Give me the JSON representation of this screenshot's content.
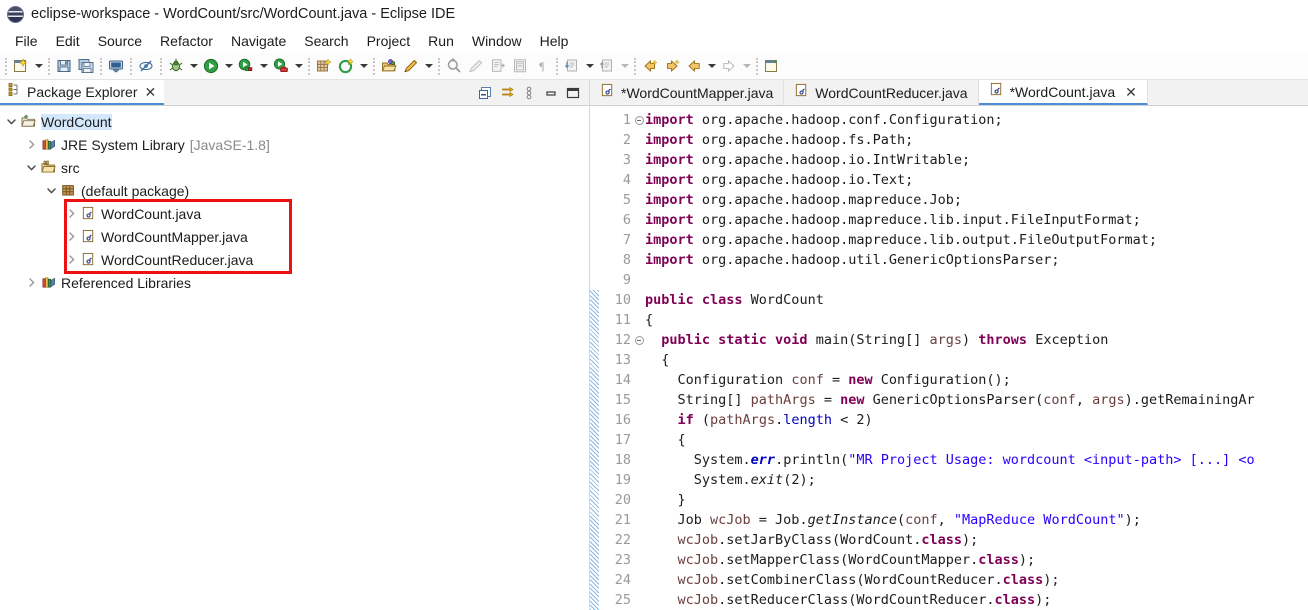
{
  "window": {
    "title": "eclipse-workspace - WordCount/src/WordCount.java - Eclipse IDE",
    "app_icon": "eclipse-logo-icon"
  },
  "menubar": {
    "items": [
      {
        "label": "File"
      },
      {
        "label": "Edit"
      },
      {
        "label": "Source"
      },
      {
        "label": "Refactor"
      },
      {
        "label": "Navigate"
      },
      {
        "label": "Search"
      },
      {
        "label": "Project"
      },
      {
        "label": "Run"
      },
      {
        "label": "Window"
      },
      {
        "label": "Help"
      }
    ]
  },
  "toolbar": {
    "groups": [
      {
        "buttons": [
          {
            "icon": "new-wizard-icon",
            "dropdown": true
          }
        ]
      },
      {
        "buttons": [
          {
            "icon": "save-icon",
            "dropdown": false
          },
          {
            "icon": "save-all-icon",
            "dropdown": false
          }
        ]
      },
      {
        "buttons": [
          {
            "icon": "print-icon",
            "dropdown": false
          }
        ]
      },
      {
        "buttons": [
          {
            "icon": "toggle-mark-occurrences-icon",
            "dropdown": false
          }
        ]
      },
      {
        "buttons": [
          {
            "icon": "debug-icon",
            "dropdown": true
          },
          {
            "icon": "run-icon",
            "dropdown": true
          },
          {
            "icon": "run-coverage-icon",
            "dropdown": true
          },
          {
            "icon": "external-tools-icon",
            "dropdown": true
          }
        ]
      },
      {
        "buttons": [
          {
            "icon": "new-java-project-icon",
            "dropdown": false
          },
          {
            "icon": "new-package-icon",
            "dropdown": true
          }
        ]
      },
      {
        "buttons": [
          {
            "icon": "open-type-icon",
            "dropdown": false
          },
          {
            "icon": "quick-fix-icon",
            "dropdown": true
          }
        ]
      },
      {
        "buttons": [
          {
            "icon": "search-icon",
            "dropdown": false
          },
          {
            "icon": "clear-icon",
            "dropdown": false
          },
          {
            "icon": "next-annotation-icon",
            "dropdown": false
          },
          {
            "icon": "last-edit-icon",
            "dropdown": false
          },
          {
            "icon": "show-whitespace-icon",
            "dropdown": false
          }
        ]
      },
      {
        "buttons": [
          {
            "icon": "next-edit-position-icon",
            "dropdown": true
          },
          {
            "icon": "previous-edit-position-icon",
            "dropdown": true
          }
        ]
      },
      {
        "buttons": [
          {
            "icon": "back-history-icon",
            "dropdown": false
          },
          {
            "icon": "forward-history-icon",
            "dropdown": false
          },
          {
            "icon": "back-arrow-icon",
            "dropdown": true
          },
          {
            "icon": "forward-arrow-icon",
            "dropdown": true
          }
        ]
      },
      {
        "buttons": [
          {
            "icon": "open-perspective-icon",
            "dropdown": false
          }
        ]
      }
    ]
  },
  "explorer": {
    "tab": {
      "label": "Package Explorer",
      "icon": "package-explorer-icon",
      "close": "✕"
    },
    "tools": [
      {
        "icon": "collapse-all-icon"
      },
      {
        "icon": "link-with-editor-icon"
      },
      {
        "icon": "view-menu-icon"
      },
      {
        "icon": "minimize-icon"
      },
      {
        "icon": "maximize-icon"
      }
    ],
    "tree": [
      {
        "label": "WordCount",
        "suffix": "",
        "icon": "java-project-icon",
        "twist": "expanded",
        "indent": 0,
        "selected": true
      },
      {
        "label": "JRE System Library",
        "suffix": "[JavaSE-1.8]",
        "icon": "library-icon",
        "twist": "collapsed",
        "indent": 1,
        "selected": false
      },
      {
        "label": "src",
        "suffix": "",
        "icon": "source-folder-icon",
        "twist": "expanded",
        "indent": 1,
        "selected": false
      },
      {
        "label": "(default package)",
        "suffix": "",
        "icon": "package-icon",
        "twist": "expanded",
        "indent": 2,
        "selected": false
      },
      {
        "label": "WordCount.java",
        "suffix": "",
        "icon": "java-file-icon",
        "twist": "collapsed",
        "indent": 3,
        "selected": false
      },
      {
        "label": "WordCountMapper.java",
        "suffix": "",
        "icon": "java-file-icon",
        "twist": "collapsed",
        "indent": 3,
        "selected": false
      },
      {
        "label": "WordCountReducer.java",
        "suffix": "",
        "icon": "java-file-icon",
        "twist": "collapsed",
        "indent": 3,
        "selected": false
      },
      {
        "label": "Referenced Libraries",
        "suffix": "",
        "icon": "library-icon",
        "twist": "collapsed",
        "indent": 1,
        "selected": false
      }
    ],
    "annotation": {
      "type": "red-rectangle-highlight",
      "color": "#ee1111",
      "covers": [
        "WordCount.java",
        "WordCountMapper.java",
        "WordCountReducer.java"
      ]
    }
  },
  "editor": {
    "tabs": [
      {
        "label": "*WordCountMapper.java",
        "icon": "java-file-icon",
        "active": false,
        "dirty": true,
        "closable": false
      },
      {
        "label": "WordCountReducer.java",
        "icon": "java-file-icon",
        "active": false,
        "dirty": false,
        "closable": false
      },
      {
        "label": "*WordCount.java",
        "icon": "java-file-icon",
        "active": true,
        "dirty": true,
        "closable": true,
        "close": "✕"
      }
    ],
    "first_line": 1,
    "lines": [
      {
        "n": 1,
        "fold": true,
        "changed": false,
        "tokens": [
          {
            "t": "import ",
            "c": "k"
          },
          {
            "t": "org.apache.hadoop.conf.Configuration;",
            "c": "n"
          }
        ]
      },
      {
        "n": 2,
        "fold": false,
        "changed": false,
        "tokens": [
          {
            "t": "import ",
            "c": "k"
          },
          {
            "t": "org.apache.hadoop.fs.Path;",
            "c": "n"
          }
        ]
      },
      {
        "n": 3,
        "fold": false,
        "changed": false,
        "tokens": [
          {
            "t": "import ",
            "c": "k"
          },
          {
            "t": "org.apache.hadoop.io.IntWritable;",
            "c": "n"
          }
        ]
      },
      {
        "n": 4,
        "fold": false,
        "changed": false,
        "tokens": [
          {
            "t": "import ",
            "c": "k"
          },
          {
            "t": "org.apache.hadoop.io.Text;",
            "c": "n"
          }
        ]
      },
      {
        "n": 5,
        "fold": false,
        "changed": false,
        "tokens": [
          {
            "t": "import ",
            "c": "k"
          },
          {
            "t": "org.apache.hadoop.mapreduce.Job;",
            "c": "n"
          }
        ]
      },
      {
        "n": 6,
        "fold": false,
        "changed": false,
        "tokens": [
          {
            "t": "import ",
            "c": "k"
          },
          {
            "t": "org.apache.hadoop.mapreduce.lib.input.FileInputFormat;",
            "c": "n"
          }
        ]
      },
      {
        "n": 7,
        "fold": false,
        "changed": false,
        "tokens": [
          {
            "t": "import ",
            "c": "k"
          },
          {
            "t": "org.apache.hadoop.mapreduce.lib.output.FileOutputFormat;",
            "c": "n"
          }
        ]
      },
      {
        "n": 8,
        "fold": false,
        "changed": false,
        "tokens": [
          {
            "t": "import ",
            "c": "k"
          },
          {
            "t": "org.apache.hadoop.util.GenericOptionsParser;",
            "c": "n"
          }
        ]
      },
      {
        "n": 9,
        "fold": false,
        "changed": false,
        "tokens": []
      },
      {
        "n": 10,
        "fold": false,
        "changed": true,
        "tokens": [
          {
            "t": "public class ",
            "c": "k"
          },
          {
            "t": "WordCount",
            "c": "n"
          }
        ]
      },
      {
        "n": 11,
        "fold": false,
        "changed": true,
        "tokens": [
          {
            "t": "{",
            "c": "n"
          }
        ]
      },
      {
        "n": 12,
        "fold": true,
        "changed": true,
        "tokens": [
          {
            "t": "  ",
            "c": "n"
          },
          {
            "t": "public static void ",
            "c": "k"
          },
          {
            "t": "main(String[] ",
            "c": "n"
          },
          {
            "t": "args",
            "c": "p"
          },
          {
            "t": ") ",
            "c": "n"
          },
          {
            "t": "throws ",
            "c": "k"
          },
          {
            "t": "Exception",
            "c": "n"
          }
        ]
      },
      {
        "n": 13,
        "fold": false,
        "changed": true,
        "tokens": [
          {
            "t": "  {",
            "c": "n"
          }
        ]
      },
      {
        "n": 14,
        "fold": false,
        "changed": true,
        "tokens": [
          {
            "t": "    Configuration ",
            "c": "n"
          },
          {
            "t": "conf",
            "c": "p"
          },
          {
            "t": " = ",
            "c": "n"
          },
          {
            "t": "new ",
            "c": "k"
          },
          {
            "t": "Configuration();",
            "c": "n"
          }
        ]
      },
      {
        "n": 15,
        "fold": false,
        "changed": true,
        "tokens": [
          {
            "t": "    String[] ",
            "c": "n"
          },
          {
            "t": "pathArgs",
            "c": "p"
          },
          {
            "t": " = ",
            "c": "n"
          },
          {
            "t": "new ",
            "c": "k"
          },
          {
            "t": "GenericOptionsParser(",
            "c": "n"
          },
          {
            "t": "conf",
            "c": "p"
          },
          {
            "t": ", ",
            "c": "n"
          },
          {
            "t": "args",
            "c": "p"
          },
          {
            "t": ").getRemainingAr",
            "c": "n"
          }
        ]
      },
      {
        "n": 16,
        "fold": false,
        "changed": true,
        "tokens": [
          {
            "t": "    ",
            "c": "n"
          },
          {
            "t": "if ",
            "c": "k"
          },
          {
            "t": "(",
            "c": "n"
          },
          {
            "t": "pathArgs",
            "c": "p"
          },
          {
            "t": ".",
            "c": "n"
          },
          {
            "t": "length",
            "c": "f"
          },
          {
            "t": " < 2)",
            "c": "n"
          }
        ]
      },
      {
        "n": 17,
        "fold": false,
        "changed": true,
        "tokens": [
          {
            "t": "    {",
            "c": "n"
          }
        ]
      },
      {
        "n": 18,
        "fold": false,
        "changed": true,
        "tokens": [
          {
            "t": "      System.",
            "c": "n"
          },
          {
            "t": "err",
            "c": "fi"
          },
          {
            "t": ".println(",
            "c": "n"
          },
          {
            "t": "\"MR Project Usage: wordcount <input-path> [...] <o",
            "c": "s"
          }
        ]
      },
      {
        "n": 19,
        "fold": false,
        "changed": true,
        "tokens": [
          {
            "t": "      System.",
            "c": "n"
          },
          {
            "t": "exit",
            "c": "mi"
          },
          {
            "t": "(2);",
            "c": "n"
          }
        ]
      },
      {
        "n": 20,
        "fold": false,
        "changed": true,
        "tokens": [
          {
            "t": "    }",
            "c": "n"
          }
        ]
      },
      {
        "n": 21,
        "fold": false,
        "changed": true,
        "tokens": [
          {
            "t": "    Job ",
            "c": "n"
          },
          {
            "t": "wcJob",
            "c": "p"
          },
          {
            "t": " = Job.",
            "c": "n"
          },
          {
            "t": "getInstance",
            "c": "mi"
          },
          {
            "t": "(",
            "c": "n"
          },
          {
            "t": "conf",
            "c": "p"
          },
          {
            "t": ", ",
            "c": "n"
          },
          {
            "t": "\"MapReduce WordCount\"",
            "c": "s"
          },
          {
            "t": ");",
            "c": "n"
          }
        ]
      },
      {
        "n": 22,
        "fold": false,
        "changed": true,
        "tokens": [
          {
            "t": "    ",
            "c": "n"
          },
          {
            "t": "wcJob",
            "c": "p"
          },
          {
            "t": ".setJarByClass(WordCount.",
            "c": "n"
          },
          {
            "t": "class",
            "c": "k"
          },
          {
            "t": ");",
            "c": "n"
          }
        ]
      },
      {
        "n": 23,
        "fold": false,
        "changed": true,
        "tokens": [
          {
            "t": "    ",
            "c": "n"
          },
          {
            "t": "wcJob",
            "c": "p"
          },
          {
            "t": ".setMapperClass(WordCountMapper.",
            "c": "n"
          },
          {
            "t": "class",
            "c": "k"
          },
          {
            "t": ");",
            "c": "n"
          }
        ]
      },
      {
        "n": 24,
        "fold": false,
        "changed": true,
        "tokens": [
          {
            "t": "    ",
            "c": "n"
          },
          {
            "t": "wcJob",
            "c": "p"
          },
          {
            "t": ".setCombinerClass(WordCountReducer.",
            "c": "n"
          },
          {
            "t": "class",
            "c": "k"
          },
          {
            "t": ");",
            "c": "n"
          }
        ]
      },
      {
        "n": 25,
        "fold": false,
        "changed": true,
        "tokens": [
          {
            "t": "    ",
            "c": "n"
          },
          {
            "t": "wcJob",
            "c": "p"
          },
          {
            "t": ".setReducerClass(WordCountReducer.",
            "c": "n"
          },
          {
            "t": "class",
            "c": "k"
          },
          {
            "t": ");",
            "c": "n"
          }
        ]
      }
    ],
    "colors": {
      "keyword": "#7f0055",
      "string": "#2a00ff",
      "field": "#0000c0",
      "parameter": "#6a3e3e",
      "line_number": "#9a9a9a",
      "active_tab_underline": "#4a90d9"
    }
  }
}
